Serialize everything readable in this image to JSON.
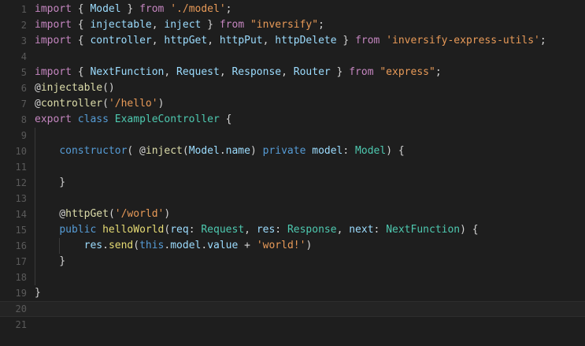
{
  "editor": {
    "line_numbers": [
      "1",
      "2",
      "3",
      "4",
      "5",
      "6",
      "7",
      "8",
      "9",
      "10",
      "11",
      "12",
      "13",
      "14",
      "15",
      "16",
      "17",
      "18",
      "19",
      "20",
      "21"
    ],
    "lines": [
      [
        {
          "t": "import",
          "c": "kw"
        },
        {
          "t": " { ",
          "c": "pu"
        },
        {
          "t": "Model",
          "c": "vr"
        },
        {
          "t": " } ",
          "c": "pu"
        },
        {
          "t": "from",
          "c": "kw"
        },
        {
          "t": " ",
          "c": "pu"
        },
        {
          "t": "'./model'",
          "c": "st"
        },
        {
          "t": ";",
          "c": "pu"
        }
      ],
      [
        {
          "t": "import",
          "c": "kw"
        },
        {
          "t": " { ",
          "c": "pu"
        },
        {
          "t": "injectable",
          "c": "vr"
        },
        {
          "t": ", ",
          "c": "pu"
        },
        {
          "t": "inject",
          "c": "vr"
        },
        {
          "t": " } ",
          "c": "pu"
        },
        {
          "t": "from",
          "c": "kw"
        },
        {
          "t": " ",
          "c": "pu"
        },
        {
          "t": "\"inversify\"",
          "c": "st"
        },
        {
          "t": ";",
          "c": "pu"
        }
      ],
      [
        {
          "t": "import",
          "c": "kw"
        },
        {
          "t": " { ",
          "c": "pu"
        },
        {
          "t": "controller",
          "c": "vr"
        },
        {
          "t": ", ",
          "c": "pu"
        },
        {
          "t": "httpGet",
          "c": "vr"
        },
        {
          "t": ", ",
          "c": "pu"
        },
        {
          "t": "httpPut",
          "c": "vr"
        },
        {
          "t": ", ",
          "c": "pu"
        },
        {
          "t": "httpDelete",
          "c": "vr"
        },
        {
          "t": " } ",
          "c": "pu"
        },
        {
          "t": "from",
          "c": "kw"
        },
        {
          "t": " ",
          "c": "pu"
        },
        {
          "t": "'inversify-express-utils'",
          "c": "st"
        },
        {
          "t": ";",
          "c": "pu"
        }
      ],
      [],
      [
        {
          "t": "import",
          "c": "kw"
        },
        {
          "t": " { ",
          "c": "pu"
        },
        {
          "t": "NextFunction",
          "c": "vr"
        },
        {
          "t": ", ",
          "c": "pu"
        },
        {
          "t": "Request",
          "c": "vr"
        },
        {
          "t": ", ",
          "c": "pu"
        },
        {
          "t": "Response",
          "c": "vr"
        },
        {
          "t": ", ",
          "c": "pu"
        },
        {
          "t": "Router",
          "c": "vr"
        },
        {
          "t": " } ",
          "c": "pu"
        },
        {
          "t": "from",
          "c": "kw"
        },
        {
          "t": " ",
          "c": "pu"
        },
        {
          "t": "\"express\"",
          "c": "st"
        },
        {
          "t": ";",
          "c": "pu"
        }
      ],
      [
        {
          "t": "@",
          "c": "pu"
        },
        {
          "t": "injectable",
          "c": "dc"
        },
        {
          "t": "()",
          "c": "pu"
        }
      ],
      [
        {
          "t": "@",
          "c": "pu"
        },
        {
          "t": "controller",
          "c": "dc"
        },
        {
          "t": "(",
          "c": "pu"
        },
        {
          "t": "'/hello'",
          "c": "st"
        },
        {
          "t": ")",
          "c": "pu"
        }
      ],
      [
        {
          "t": "export",
          "c": "kw"
        },
        {
          "t": " ",
          "c": "pu"
        },
        {
          "t": "class",
          "c": "bl"
        },
        {
          "t": " ",
          "c": "pu"
        },
        {
          "t": "ExampleController",
          "c": "ty"
        },
        {
          "t": " {",
          "c": "pu"
        }
      ],
      [],
      [
        {
          "t": "    ",
          "c": "pu"
        },
        {
          "t": "constructor",
          "c": "bl"
        },
        {
          "t": "( @",
          "c": "pu"
        },
        {
          "t": "inject",
          "c": "dc"
        },
        {
          "t": "(",
          "c": "pu"
        },
        {
          "t": "Model",
          "c": "vr"
        },
        {
          "t": ".",
          "c": "pu"
        },
        {
          "t": "name",
          "c": "vr"
        },
        {
          "t": ") ",
          "c": "pu"
        },
        {
          "t": "private",
          "c": "bl"
        },
        {
          "t": " ",
          "c": "pu"
        },
        {
          "t": "model",
          "c": "vr"
        },
        {
          "t": ": ",
          "c": "pu"
        },
        {
          "t": "Model",
          "c": "ty"
        },
        {
          "t": ") {",
          "c": "pu"
        }
      ],
      [],
      [
        {
          "t": "    }",
          "c": "pu"
        }
      ],
      [],
      [
        {
          "t": "    @",
          "c": "pu"
        },
        {
          "t": "httpGet",
          "c": "dc"
        },
        {
          "t": "(",
          "c": "pu"
        },
        {
          "t": "'/world'",
          "c": "st"
        },
        {
          "t": ")",
          "c": "pu"
        }
      ],
      [
        {
          "t": "    ",
          "c": "pu"
        },
        {
          "t": "public",
          "c": "bl"
        },
        {
          "t": " ",
          "c": "pu"
        },
        {
          "t": "helloWorld",
          "c": "fn"
        },
        {
          "t": "(",
          "c": "pu"
        },
        {
          "t": "req",
          "c": "vr"
        },
        {
          "t": ": ",
          "c": "pu"
        },
        {
          "t": "Request",
          "c": "ty"
        },
        {
          "t": ", ",
          "c": "pu"
        },
        {
          "t": "res",
          "c": "vr"
        },
        {
          "t": ": ",
          "c": "pu"
        },
        {
          "t": "Response",
          "c": "ty"
        },
        {
          "t": ", ",
          "c": "pu"
        },
        {
          "t": "next",
          "c": "vr"
        },
        {
          "t": ": ",
          "c": "pu"
        },
        {
          "t": "NextFunction",
          "c": "ty"
        },
        {
          "t": ") {",
          "c": "pu"
        }
      ],
      [
        {
          "t": "        ",
          "c": "pu"
        },
        {
          "t": "res",
          "c": "vr"
        },
        {
          "t": ".",
          "c": "pu"
        },
        {
          "t": "send",
          "c": "fn"
        },
        {
          "t": "(",
          "c": "pu"
        },
        {
          "t": "this",
          "c": "bl"
        },
        {
          "t": ".",
          "c": "pu"
        },
        {
          "t": "model",
          "c": "vr"
        },
        {
          "t": ".",
          "c": "pu"
        },
        {
          "t": "value",
          "c": "vr"
        },
        {
          "t": " + ",
          "c": "pu"
        },
        {
          "t": "'world!'",
          "c": "st"
        },
        {
          "t": ")",
          "c": "pu"
        }
      ],
      [
        {
          "t": "    }",
          "c": "pu"
        }
      ],
      [],
      [
        {
          "t": "}",
          "c": "pu"
        }
      ],
      [],
      []
    ],
    "current_line": 20
  }
}
